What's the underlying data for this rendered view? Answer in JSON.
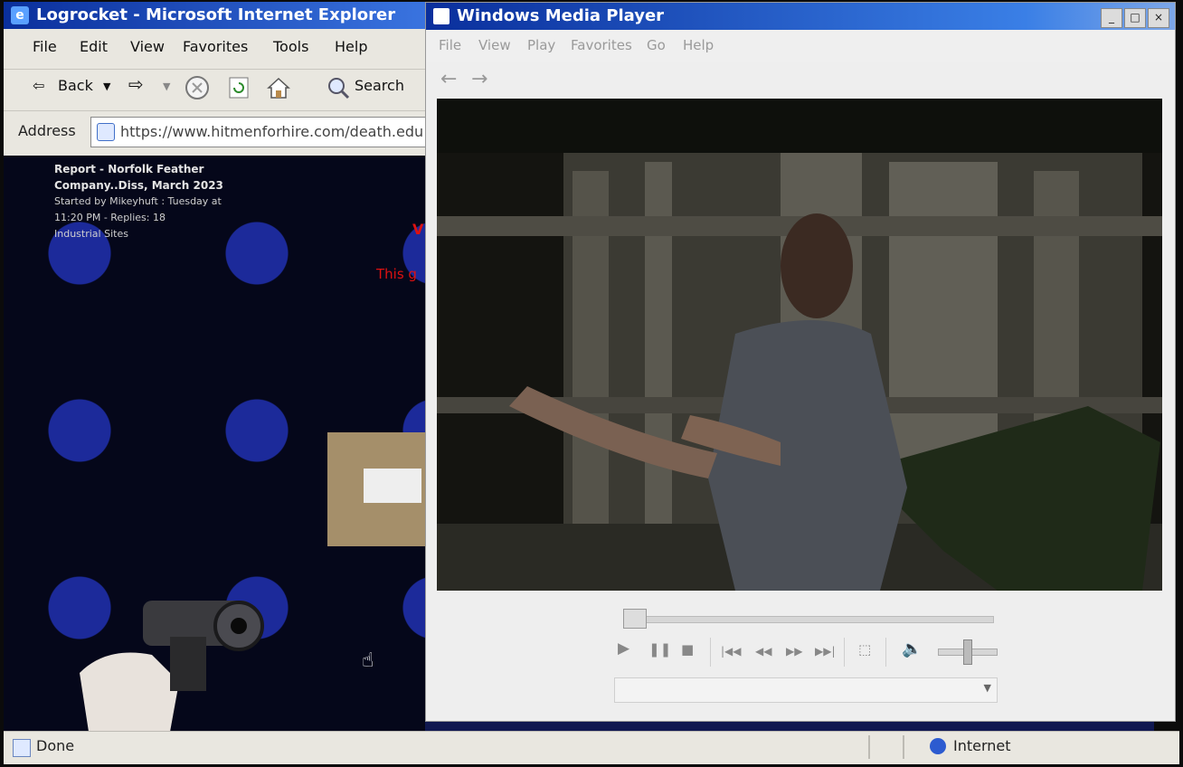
{
  "ie": {
    "title": "Logrocket - Microsoft Internet Explorer",
    "menu": [
      "File",
      "Edit",
      "View",
      "Favorites",
      "Tools",
      "Help"
    ],
    "toolbar": {
      "back": "Back",
      "search": "Search"
    },
    "address_label": "Address",
    "url": "https://www.hitmenforhire.com/death.edu",
    "post": {
      "title_line1": "Report - Norfolk Feather",
      "title_line2": "Company..Diss, March 2023",
      "meta_line1": "Started by Mikeyhuft : Tuesday at",
      "meta_line2": "11:20 PM - Replies: 18",
      "meta_line3": "Industrial Sites"
    },
    "page_red_text": "This g",
    "page_red_letter": "V",
    "status_text": "Done",
    "zone_text": "Internet"
  },
  "wmp": {
    "title": "Windows Media Player",
    "menu": [
      "File",
      "View",
      "Play",
      "Favorites",
      "Go",
      "Help"
    ],
    "window_buttons": {
      "minimize": "_",
      "maximize": "□",
      "close": "×"
    }
  },
  "colors": {
    "titlebar": "#0a2f9c",
    "page_bg": "#05071a",
    "swirl": "#1c2a9a",
    "red_text": "#d11111"
  }
}
